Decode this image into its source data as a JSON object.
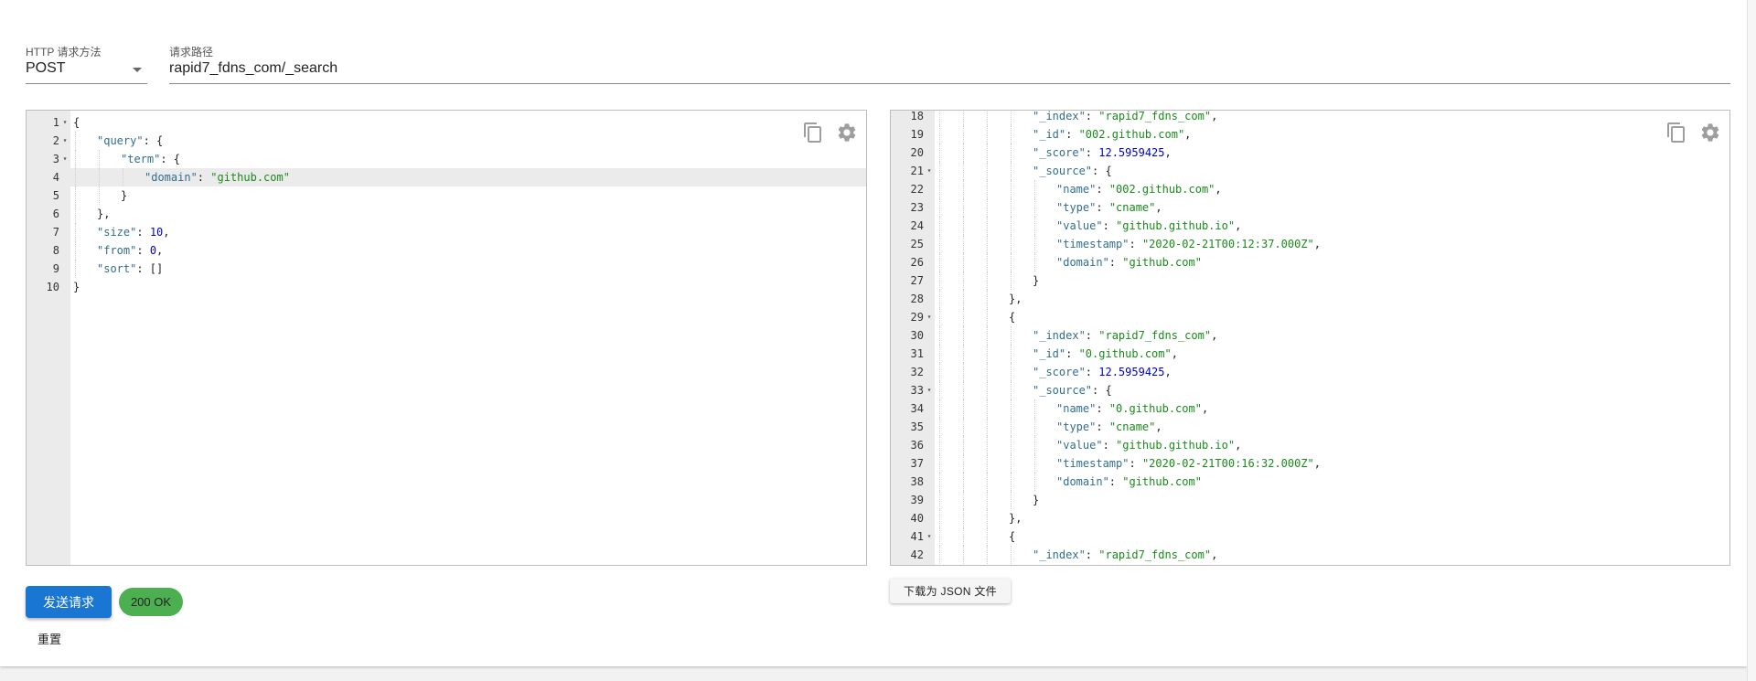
{
  "request": {
    "method_label": "HTTP 请求方法",
    "method": "POST",
    "path_label": "请求路径",
    "path": "rapid7_fdns_com/_search"
  },
  "query_editor": {
    "lines": [
      {
        "n": "1",
        "fold": true,
        "indent": 0,
        "tokens": [
          [
            "p",
            "{"
          ]
        ]
      },
      {
        "n": "2",
        "fold": true,
        "indent": 1,
        "tokens": [
          [
            "k",
            "\"query\""
          ],
          [
            "p",
            ": {"
          ]
        ]
      },
      {
        "n": "3",
        "fold": true,
        "indent": 2,
        "tokens": [
          [
            "k",
            "\"term\""
          ],
          [
            "p",
            ": {"
          ]
        ]
      },
      {
        "n": "4",
        "fold": false,
        "indent": 3,
        "active": true,
        "tokens": [
          [
            "k",
            "\"domain\""
          ],
          [
            "p",
            ": "
          ],
          [
            "s",
            "\"github.com\""
          ]
        ]
      },
      {
        "n": "5",
        "fold": false,
        "indent": 2,
        "tokens": [
          [
            "p",
            "}"
          ]
        ]
      },
      {
        "n": "6",
        "fold": false,
        "indent": 1,
        "tokens": [
          [
            "p",
            "},"
          ]
        ]
      },
      {
        "n": "7",
        "fold": false,
        "indent": 1,
        "tokens": [
          [
            "k",
            "\"size\""
          ],
          [
            "p",
            ": "
          ],
          [
            "n",
            "10"
          ],
          [
            "p",
            ","
          ]
        ]
      },
      {
        "n": "8",
        "fold": false,
        "indent": 1,
        "tokens": [
          [
            "k",
            "\"from\""
          ],
          [
            "p",
            ": "
          ],
          [
            "n",
            "0"
          ],
          [
            "p",
            ","
          ]
        ]
      },
      {
        "n": "9",
        "fold": false,
        "indent": 1,
        "tokens": [
          [
            "k",
            "\"sort\""
          ],
          [
            "p",
            ": []"
          ]
        ]
      },
      {
        "n": "10",
        "fold": false,
        "indent": 0,
        "tokens": [
          [
            "p",
            "}"
          ]
        ]
      }
    ]
  },
  "response_editor": {
    "lines": [
      {
        "n": "18",
        "fold": false,
        "indent": 4,
        "tokens": [
          [
            "k",
            "\"_index\""
          ],
          [
            "p",
            ": "
          ],
          [
            "s",
            "\"rapid7_fdns_com\""
          ],
          [
            "p",
            ","
          ]
        ]
      },
      {
        "n": "19",
        "fold": false,
        "indent": 4,
        "tokens": [
          [
            "k",
            "\"_id\""
          ],
          [
            "p",
            ": "
          ],
          [
            "s",
            "\"002.github.com\""
          ],
          [
            "p",
            ","
          ]
        ]
      },
      {
        "n": "20",
        "fold": false,
        "indent": 4,
        "tokens": [
          [
            "k",
            "\"_score\""
          ],
          [
            "p",
            ": "
          ],
          [
            "n",
            "12.5959425"
          ],
          [
            "p",
            ","
          ]
        ]
      },
      {
        "n": "21",
        "fold": true,
        "indent": 4,
        "tokens": [
          [
            "k",
            "\"_source\""
          ],
          [
            "p",
            ": {"
          ]
        ]
      },
      {
        "n": "22",
        "fold": false,
        "indent": 5,
        "tokens": [
          [
            "k",
            "\"name\""
          ],
          [
            "p",
            ": "
          ],
          [
            "s",
            "\"002.github.com\""
          ],
          [
            "p",
            ","
          ]
        ]
      },
      {
        "n": "23",
        "fold": false,
        "indent": 5,
        "tokens": [
          [
            "k",
            "\"type\""
          ],
          [
            "p",
            ": "
          ],
          [
            "s",
            "\"cname\""
          ],
          [
            "p",
            ","
          ]
        ]
      },
      {
        "n": "24",
        "fold": false,
        "indent": 5,
        "tokens": [
          [
            "k",
            "\"value\""
          ],
          [
            "p",
            ": "
          ],
          [
            "s",
            "\"github.github.io\""
          ],
          [
            "p",
            ","
          ]
        ]
      },
      {
        "n": "25",
        "fold": false,
        "indent": 5,
        "tokens": [
          [
            "k",
            "\"timestamp\""
          ],
          [
            "p",
            ": "
          ],
          [
            "s",
            "\"2020-02-21T00:12:37.000Z\""
          ],
          [
            "p",
            ","
          ]
        ]
      },
      {
        "n": "26",
        "fold": false,
        "indent": 5,
        "tokens": [
          [
            "k",
            "\"domain\""
          ],
          [
            "p",
            ": "
          ],
          [
            "s",
            "\"github.com\""
          ]
        ]
      },
      {
        "n": "27",
        "fold": false,
        "indent": 4,
        "tokens": [
          [
            "p",
            "}"
          ]
        ]
      },
      {
        "n": "28",
        "fold": false,
        "indent": 3,
        "tokens": [
          [
            "p",
            "},"
          ]
        ]
      },
      {
        "n": "29",
        "fold": true,
        "indent": 3,
        "tokens": [
          [
            "p",
            "{"
          ]
        ]
      },
      {
        "n": "30",
        "fold": false,
        "indent": 4,
        "tokens": [
          [
            "k",
            "\"_index\""
          ],
          [
            "p",
            ": "
          ],
          [
            "s",
            "\"rapid7_fdns_com\""
          ],
          [
            "p",
            ","
          ]
        ]
      },
      {
        "n": "31",
        "fold": false,
        "indent": 4,
        "tokens": [
          [
            "k",
            "\"_id\""
          ],
          [
            "p",
            ": "
          ],
          [
            "s",
            "\"0.github.com\""
          ],
          [
            "p",
            ","
          ]
        ]
      },
      {
        "n": "32",
        "fold": false,
        "indent": 4,
        "tokens": [
          [
            "k",
            "\"_score\""
          ],
          [
            "p",
            ": "
          ],
          [
            "n",
            "12.5959425"
          ],
          [
            "p",
            ","
          ]
        ]
      },
      {
        "n": "33",
        "fold": true,
        "indent": 4,
        "tokens": [
          [
            "k",
            "\"_source\""
          ],
          [
            "p",
            ": {"
          ]
        ]
      },
      {
        "n": "34",
        "fold": false,
        "indent": 5,
        "tokens": [
          [
            "k",
            "\"name\""
          ],
          [
            "p",
            ": "
          ],
          [
            "s",
            "\"0.github.com\""
          ],
          [
            "p",
            ","
          ]
        ]
      },
      {
        "n": "35",
        "fold": false,
        "indent": 5,
        "tokens": [
          [
            "k",
            "\"type\""
          ],
          [
            "p",
            ": "
          ],
          [
            "s",
            "\"cname\""
          ],
          [
            "p",
            ","
          ]
        ]
      },
      {
        "n": "36",
        "fold": false,
        "indent": 5,
        "tokens": [
          [
            "k",
            "\"value\""
          ],
          [
            "p",
            ": "
          ],
          [
            "s",
            "\"github.github.io\""
          ],
          [
            "p",
            ","
          ]
        ]
      },
      {
        "n": "37",
        "fold": false,
        "indent": 5,
        "tokens": [
          [
            "k",
            "\"timestamp\""
          ],
          [
            "p",
            ": "
          ],
          [
            "s",
            "\"2020-02-21T00:16:32.000Z\""
          ],
          [
            "p",
            ","
          ]
        ]
      },
      {
        "n": "38",
        "fold": false,
        "indent": 5,
        "tokens": [
          [
            "k",
            "\"domain\""
          ],
          [
            "p",
            ": "
          ],
          [
            "s",
            "\"github.com\""
          ]
        ]
      },
      {
        "n": "39",
        "fold": false,
        "indent": 4,
        "tokens": [
          [
            "p",
            "}"
          ]
        ]
      },
      {
        "n": "40",
        "fold": false,
        "indent": 3,
        "tokens": [
          [
            "p",
            "},"
          ]
        ]
      },
      {
        "n": "41",
        "fold": true,
        "indent": 3,
        "tokens": [
          [
            "p",
            "{"
          ]
        ]
      },
      {
        "n": "42",
        "fold": false,
        "indent": 4,
        "tokens": [
          [
            "k",
            "\"_index\""
          ],
          [
            "p",
            ": "
          ],
          [
            "s",
            "\"rapid7_fdns_com\""
          ],
          [
            "p",
            ","
          ]
        ]
      }
    ]
  },
  "icons": {
    "copy": "copy-icon",
    "settings": "gear-icon",
    "dropdown": "chevron-down-icon"
  },
  "actions": {
    "send_label": "发送请求",
    "status": "200 OK",
    "reset_label": "重置",
    "download_label": "下载为 JSON 文件"
  },
  "colors": {
    "primary": "#1976d2",
    "success": "#4caf50",
    "json_key": "#316e8d",
    "json_string": "#1a8a1a",
    "json_number": "#0000cd"
  }
}
